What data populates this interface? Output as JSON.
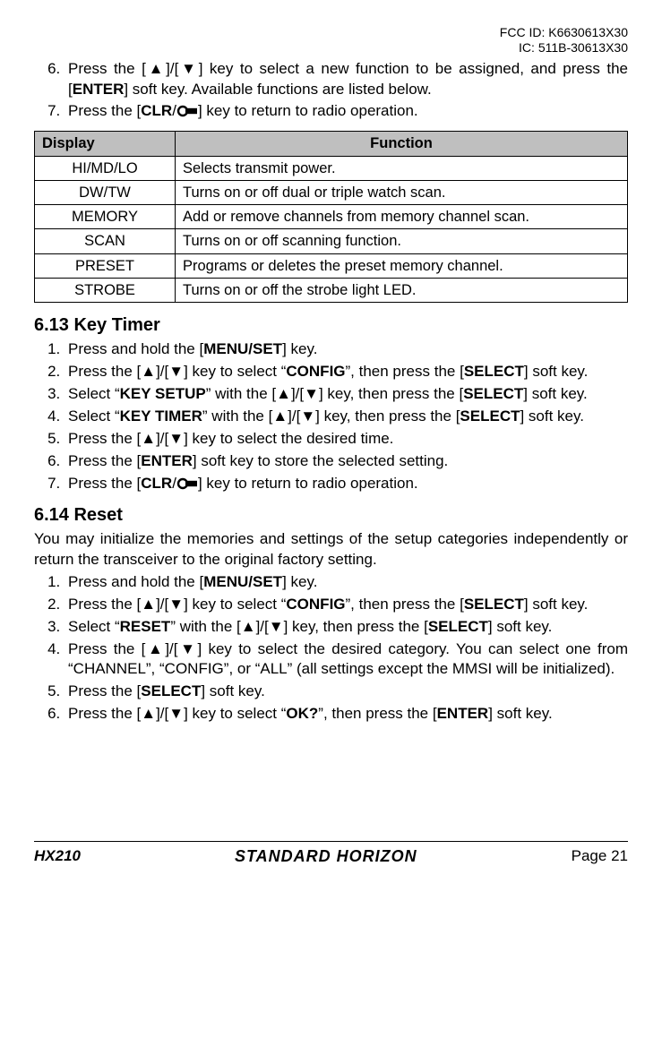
{
  "fcc": {
    "line1": "FCC ID: K6630613X30",
    "line2": "IC: 511B-30613X30"
  },
  "top_steps_start": 6,
  "top_steps": [
    {
      "pre": "Press the [▲]/[▼] key to select a new function to be assigned, and press the [",
      "b": "ENTER",
      "post": "] soft key. Available functions are listed below."
    },
    {
      "pre": "Press the [",
      "b": "CLR",
      "post_pre": "/",
      "icon": true,
      "post": "] key to return to radio operation."
    }
  ],
  "table": {
    "head_display": "Display",
    "head_function": "Function",
    "rows": [
      {
        "d": "HI/MD/LO",
        "f": "Selects transmit power."
      },
      {
        "d": "DW/TW",
        "f": "Turns on or off dual or triple watch scan."
      },
      {
        "d": "MEMORY",
        "f": "Add or remove channels from memory channel scan."
      },
      {
        "d": "SCAN",
        "f": "Turns on or off scanning function."
      },
      {
        "d": "PRESET",
        "f": "Programs or deletes the preset memory channel."
      },
      {
        "d": "STROBE",
        "f": "Turns on or off the strobe light LED."
      }
    ]
  },
  "s613": {
    "heading": "6.13 Key Timer",
    "steps": [
      [
        {
          "t": "Press and hold the ["
        },
        {
          "b": "MENU/SET"
        },
        {
          "t": "] key."
        }
      ],
      [
        {
          "t": "Press the [▲]/[▼] key to select “"
        },
        {
          "b": "CONFIG"
        },
        {
          "t": "”, then press the ["
        },
        {
          "b": "SELECT"
        },
        {
          "t": "] soft key."
        }
      ],
      [
        {
          "t": "Select “"
        },
        {
          "b": "KEY SETUP"
        },
        {
          "t": "” with the [▲]/[▼] key, then press the ["
        },
        {
          "b": "SELECT"
        },
        {
          "t": "] soft key."
        }
      ],
      [
        {
          "t": "Select “"
        },
        {
          "b": "KEY TIMER"
        },
        {
          "t": "” with the [▲]/[▼] key, then press the ["
        },
        {
          "b": "SELECT"
        },
        {
          "t": "] soft key."
        }
      ],
      [
        {
          "t": "Press the [▲]/[▼] key to select the desired time."
        }
      ],
      [
        {
          "t": "Press the ["
        },
        {
          "b": "ENTER"
        },
        {
          "t": "] soft key to store the selected setting."
        }
      ],
      [
        {
          "t": "Press the ["
        },
        {
          "b": "CLR"
        },
        {
          "t": "/"
        },
        {
          "icon": true
        },
        {
          "t": "] key to return to radio operation."
        }
      ]
    ]
  },
  "s614": {
    "heading": "6.14 Reset",
    "intro": "You may initialize the memories and settings of the setup categories independently or return the transceiver to the original factory setting.",
    "steps": [
      [
        {
          "t": "Press and hold the ["
        },
        {
          "b": "MENU/SET"
        },
        {
          "t": "] key."
        }
      ],
      [
        {
          "t": "Press the [▲]/[▼] key to select “"
        },
        {
          "b": "CONFIG"
        },
        {
          "t": "”, then press the ["
        },
        {
          "b": "SELECT"
        },
        {
          "t": "] soft key."
        }
      ],
      [
        {
          "t": "Select “"
        },
        {
          "b": "RESET"
        },
        {
          "t": "” with the [▲]/[▼] key, then press the ["
        },
        {
          "b": "SELECT"
        },
        {
          "t": "] soft key."
        }
      ],
      [
        {
          "t": "Press the [▲]/[▼] key to select the desired category. You can select one from “CHANNEL”, “CONFIG”, or “ALL” (all settings except the MMSI will be initialized)."
        }
      ],
      [
        {
          "t": "Press the ["
        },
        {
          "b": "SELECT"
        },
        {
          "t": "] soft key."
        }
      ],
      [
        {
          "t": "Press the [▲]/[▼] key to select “"
        },
        {
          "b": "OK?"
        },
        {
          "t": "”, then press the ["
        },
        {
          "b": "ENTER"
        },
        {
          "t": "] soft key."
        }
      ]
    ]
  },
  "footer": {
    "model": "HX210",
    "brand": "STANDARD HORIZON",
    "page": "Page 21"
  }
}
